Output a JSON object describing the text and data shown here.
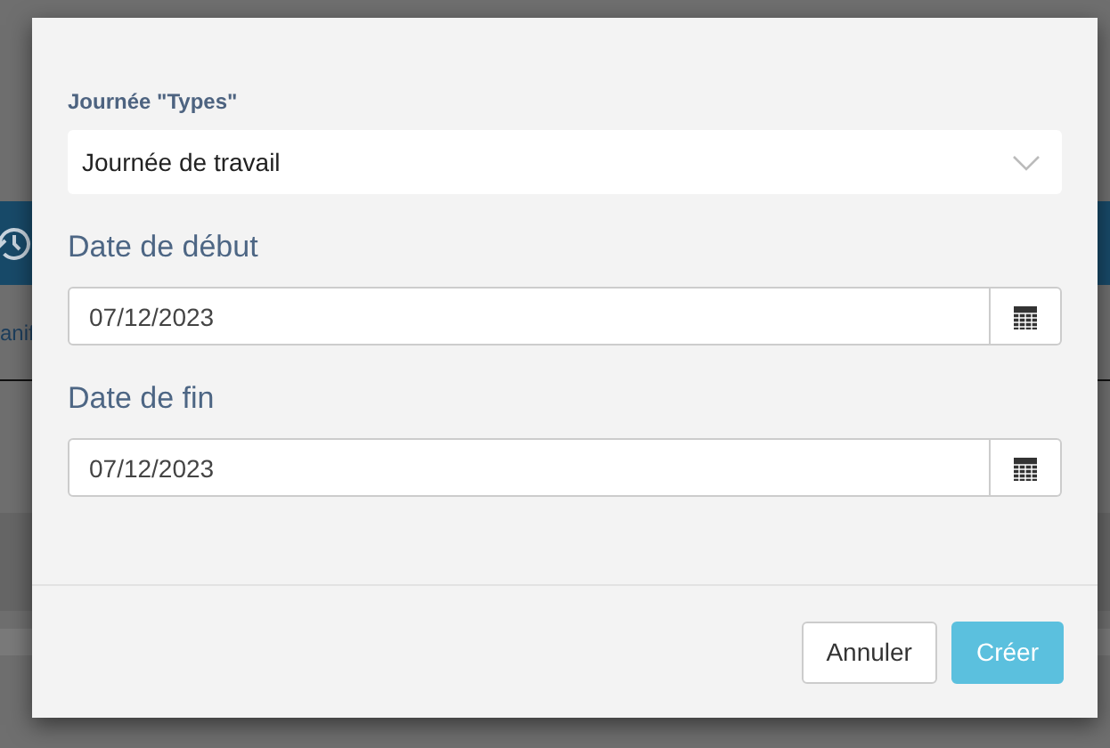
{
  "background": {
    "nav_fragment": "anif"
  },
  "dialog": {
    "type_field": {
      "label": "Journée \"Types\"",
      "value": "Journée de travail"
    },
    "date_fields": [
      {
        "label": "Date de début",
        "value": "07/12/2023"
      },
      {
        "label": "Date de fin",
        "value": "07/12/2023"
      }
    ],
    "buttons": [
      {
        "label": "Annuler",
        "kind": "default"
      },
      {
        "label": "Créer",
        "kind": "primary"
      }
    ]
  }
}
